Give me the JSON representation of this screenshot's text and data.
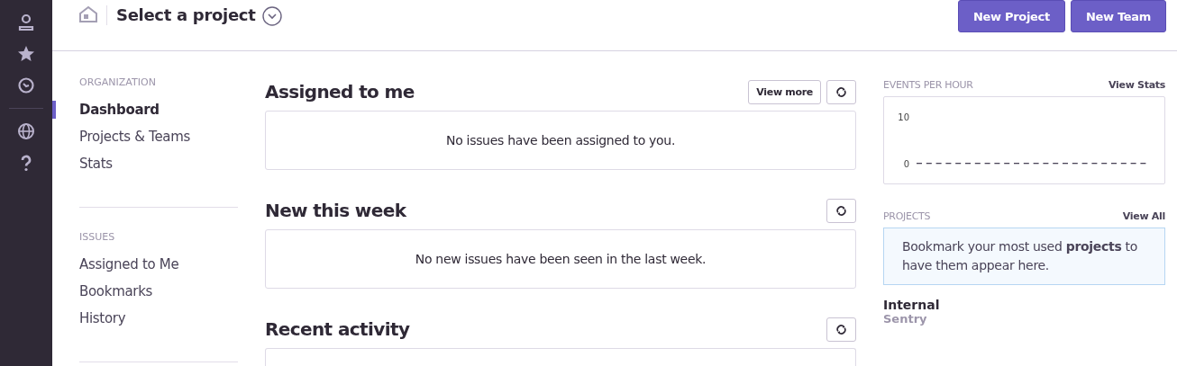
{
  "header": {
    "title": "Select a project",
    "buttons": [
      "New Project",
      "New Team"
    ]
  },
  "nav": [
    {
      "heading": "ORGANIZATION",
      "items": [
        {
          "label": "Dashboard",
          "selected": true
        },
        {
          "label": "Projects & Teams",
          "selected": false
        },
        {
          "label": "Stats",
          "selected": false
        }
      ]
    },
    {
      "heading": "ISSUES",
      "items": [
        {
          "label": "Assigned to Me",
          "selected": false
        },
        {
          "label": "Bookmarks",
          "selected": false
        },
        {
          "label": "History",
          "selected": false
        }
      ]
    }
  ],
  "sections": [
    {
      "title": "Assigned to me",
      "button": "View more",
      "message": "No issues have been assigned to you."
    },
    {
      "title": "New this week",
      "message": "No new issues have been seen in the last week."
    },
    {
      "title": "Recent activity"
    }
  ],
  "events": {
    "heading": "EVENTS PER HOUR",
    "link": "View Stats",
    "axis_labels": [
      "10",
      "0"
    ]
  },
  "projects": {
    "heading": "PROJECTS",
    "link": "View All",
    "notice": "Bookmark your most used **projects** to have them appear here.",
    "team": "Internal",
    "org": "Sentry"
  }
}
